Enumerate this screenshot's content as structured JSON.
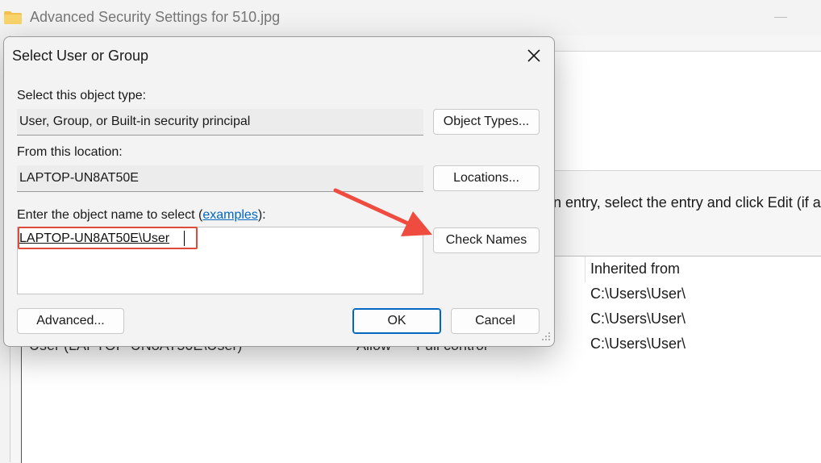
{
  "background_window": {
    "title": "Advanced Security Settings for 510.jpg",
    "instruction_fragment": "n entry, select the entry and click Edit (if ava",
    "columns": {
      "inherited_from": "Inherited from"
    },
    "rows": [
      {
        "principal": "User (LAPTOP-UN8AT50E\\User)",
        "type": "Allow",
        "access": "Full control",
        "inherited_from": "C:\\Users\\User\\"
      }
    ],
    "inherited_values": [
      "C:\\Users\\User\\",
      "C:\\Users\\User\\",
      "C:\\Users\\User\\"
    ]
  },
  "dialog": {
    "title": "Select User or Group",
    "object_type_label": "Select this object type:",
    "object_type_value": "User, Group, or Built-in security principal",
    "object_types_button": "Object Types...",
    "location_label": "From this location:",
    "location_value": "LAPTOP-UN8AT50E",
    "locations_button": "Locations...",
    "name_label_prefix": "Enter the object name to select (",
    "name_label_link": "examples",
    "name_label_suffix": "):",
    "name_value": "LAPTOP-UN8AT50E\\User",
    "check_names_button": "Check Names",
    "advanced_button": "Advanced...",
    "ok_button": "OK",
    "cancel_button": "Cancel"
  },
  "colors": {
    "accent": "#0067c0",
    "highlight_box": "#e14a3b",
    "annotation_arrow": "#ef4b3f"
  },
  "icons": [
    "folder-icon",
    "close-icon",
    "resize-grip-icon",
    "annotation-arrow"
  ]
}
